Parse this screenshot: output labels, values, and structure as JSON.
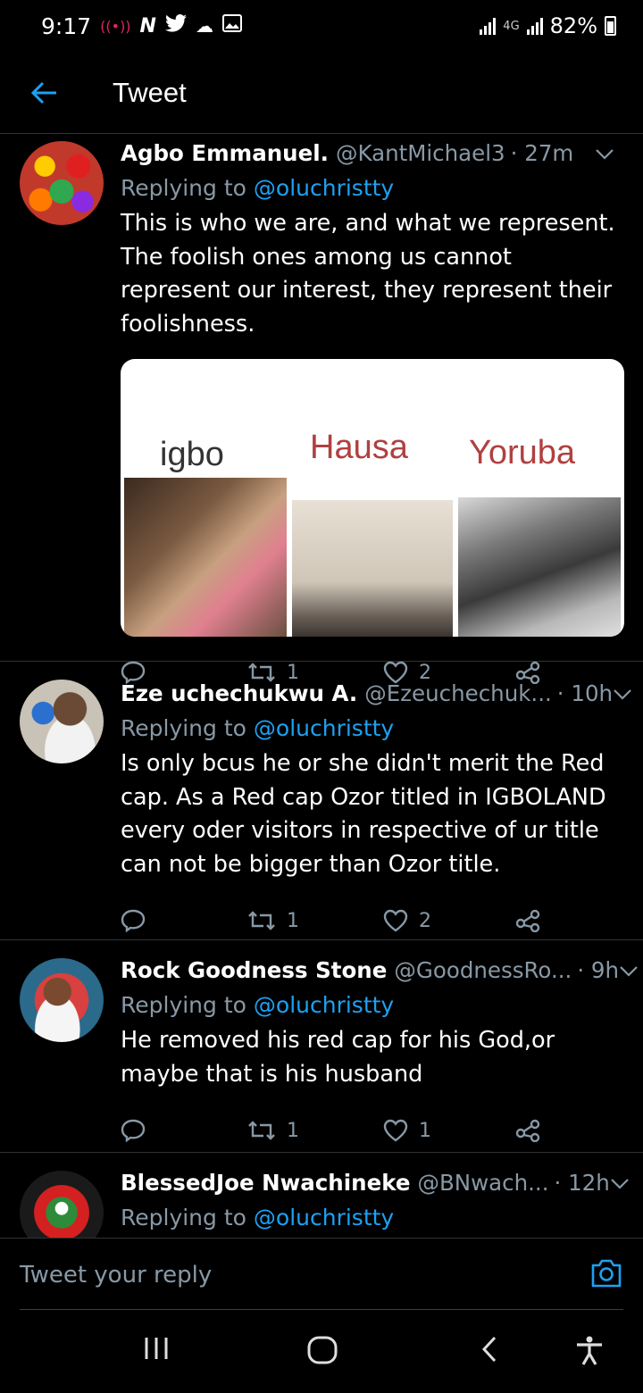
{
  "status_bar": {
    "time": "9:17",
    "network": "4G",
    "battery": "82%"
  },
  "header": {
    "title": "Tweet"
  },
  "tweets": [
    {
      "name": "Agbo Emmanuel.",
      "handle": "@KantMichael3",
      "time": "· 27m",
      "replying_prefix": "Replying to",
      "replying_to": "@oluchristty",
      "text": "This is who we are, and what we represent. The foolish ones among us cannot represent our interest, they represent their foolishness.",
      "media_labels": [
        "igbo",
        "Hausa",
        "Yoruba"
      ],
      "retweets": "1",
      "likes": "2"
    },
    {
      "name": "Eze uchechukwu A.",
      "handle": "@Ezeuchechuk...",
      "time": "· 10h",
      "replying_prefix": "Replying to",
      "replying_to": "@oluchristty",
      "text": "Is only bcus he or she didn't merit the Red cap. As a Red cap Ozor titled in IGBOLAND every oder visitors in respective of ur title can not be bigger than Ozor title.",
      "retweets": "1",
      "likes": "2"
    },
    {
      "name": "Rock Goodness Stone",
      "handle": "@GoodnessRo...",
      "time": "· 9h",
      "replying_prefix": "Replying to",
      "replying_to": "@oluchristty",
      "text": "He removed his red cap for his God,or maybe that is his husband",
      "retweets": "1",
      "likes": "1"
    },
    {
      "name": "BlessedJoe Nwachineke",
      "handle": "@BNwach...",
      "time": "· 12h",
      "replying_prefix": "Replying to",
      "replying_to": "@oluchristty"
    }
  ],
  "reply_bar": {
    "placeholder": "Tweet your reply"
  },
  "colors": {
    "accent": "#1da1f2",
    "muted": "#8899a6",
    "background": "#000000",
    "divider": "#2f3336"
  }
}
